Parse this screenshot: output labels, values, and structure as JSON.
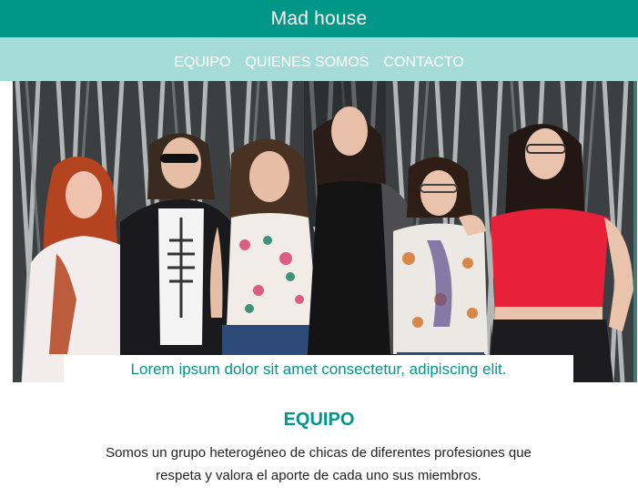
{
  "header": {
    "title": "Mad house"
  },
  "nav": {
    "items": [
      {
        "label": "EQUIPO"
      },
      {
        "label": "QUIENES SOMOS"
      },
      {
        "label": "CONTACTO"
      }
    ]
  },
  "hero": {
    "caption": "Lorem ipsum dolor sit amet consectetur, adipiscing elit."
  },
  "equipo": {
    "title": "EQUIPO",
    "body": "Somos un grupo heterogéneo de chicas de diferentes profesiones que respeta y valora el aporte de cada uno sus miembros."
  },
  "colors": {
    "accent": "#009688",
    "nav_bg": "#a6dcd7",
    "text": "#222222"
  }
}
